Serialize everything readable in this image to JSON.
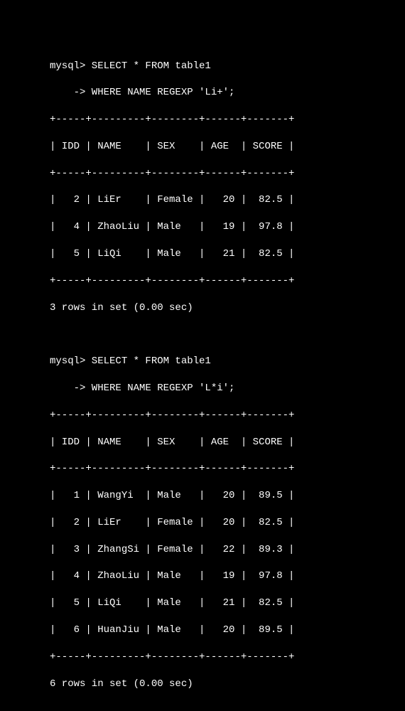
{
  "query1": {
    "prompt1": "mysql> SELECT * FROM table1",
    "prompt2": "    -> WHERE NAME REGEXP 'Li+';",
    "border_top": "+-----+---------+--------+------+-------+",
    "header": "| IDD | NAME    | SEX    | AGE  | SCORE |",
    "border_mid": "+-----+---------+--------+------+-------+",
    "rows": [
      "|   2 | LiEr    | Female |   20 |  82.5 |",
      "|   4 | ZhaoLiu | Male   |   19 |  97.8 |",
      "|   5 | LiQi    | Male   |   21 |  82.5 |"
    ],
    "border_bot": "+-----+---------+--------+------+-------+",
    "status": "3 rows in set (0.00 sec)"
  },
  "query2": {
    "prompt1": "mysql> SELECT * FROM table1",
    "prompt2": "    -> WHERE NAME REGEXP 'L*i';",
    "border_top": "+-----+---------+--------+------+-------+",
    "header": "| IDD | NAME    | SEX    | AGE  | SCORE |",
    "border_mid": "+-----+---------+--------+------+-------+",
    "rows": [
      "|   1 | WangYi  | Male   |   20 |  89.5 |",
      "|   2 | LiEr    | Female |   20 |  82.5 |",
      "|   3 | ZhangSi | Female |   22 |  89.3 |",
      "|   4 | ZhaoLiu | Male   |   19 |  97.8 |",
      "|   5 | LiQi    | Male   |   21 |  82.5 |",
      "|   6 | HuanJiu | Male   |   20 |  89.5 |"
    ],
    "border_bot": "+-----+---------+--------+------+-------+",
    "status": "6 rows in set (0.00 sec)"
  },
  "chart_data": [
    {
      "type": "table",
      "title": "SELECT * FROM table1 WHERE NAME REGEXP 'Li+'",
      "columns": [
        "IDD",
        "NAME",
        "SEX",
        "AGE",
        "SCORE"
      ],
      "rows": [
        [
          2,
          "LiEr",
          "Female",
          20,
          82.5
        ],
        [
          4,
          "ZhaoLiu",
          "Male",
          19,
          97.8
        ],
        [
          5,
          "LiQi",
          "Male",
          21,
          82.5
        ]
      ]
    },
    {
      "type": "table",
      "title": "SELECT * FROM table1 WHERE NAME REGEXP 'L*i'",
      "columns": [
        "IDD",
        "NAME",
        "SEX",
        "AGE",
        "SCORE"
      ],
      "rows": [
        [
          1,
          "WangYi",
          "Male",
          20,
          89.5
        ],
        [
          2,
          "LiEr",
          "Female",
          20,
          82.5
        ],
        [
          3,
          "ZhangSi",
          "Female",
          22,
          89.3
        ],
        [
          4,
          "ZhaoLiu",
          "Male",
          19,
          97.8
        ],
        [
          5,
          "LiQi",
          "Male",
          21,
          82.5
        ],
        [
          6,
          "HuanJiu",
          "Male",
          20,
          89.5
        ]
      ]
    }
  ]
}
